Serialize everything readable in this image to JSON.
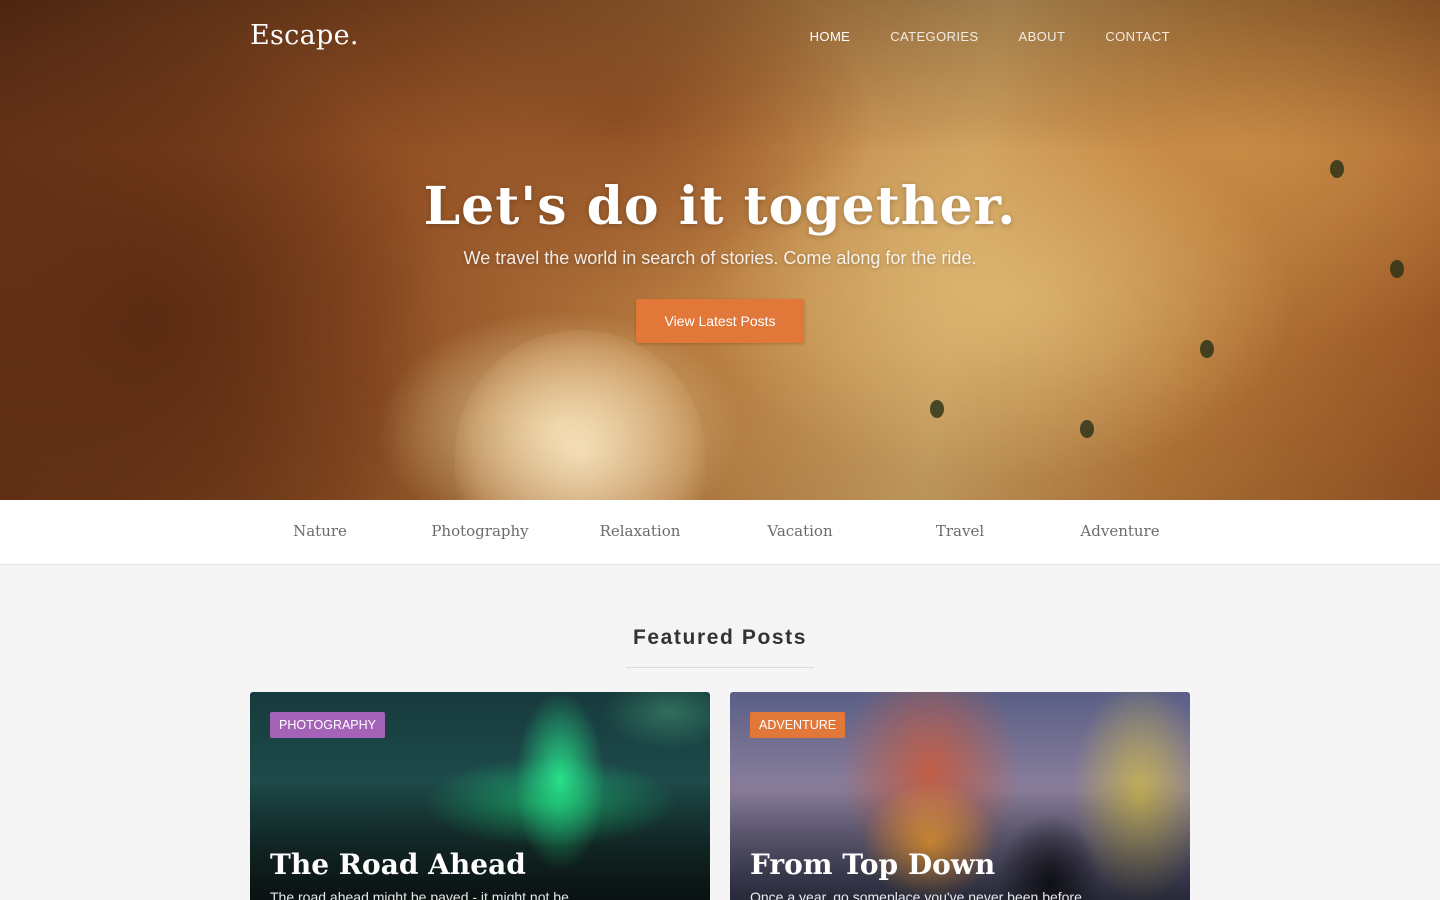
{
  "site": {
    "brand": "Escape.",
    "nav": [
      "HOME",
      "CATEGORIES",
      "ABOUT",
      "CONTACT"
    ],
    "active_nav": "HOME"
  },
  "hero": {
    "title": "Let's do it together.",
    "subtitle": "We travel the world in search of stories. Come along for the ride.",
    "button_label": "View Latest Posts"
  },
  "categories": [
    "Nature",
    "Photography",
    "Relaxation",
    "Vacation",
    "Travel",
    "Adventure"
  ],
  "featured": {
    "title": "Featured Posts",
    "posts": [
      {
        "badge": "PHOTOGRAPHY",
        "badge_color": "#a463b6",
        "title": "The Road Ahead",
        "excerpt": "The road ahead might be paved - it might not be."
      },
      {
        "badge": "ADVENTURE",
        "badge_color": "#e1783a",
        "title": "From Top Down",
        "excerpt": "Once a year, go someplace you've never been before."
      }
    ]
  },
  "colors": {
    "accent": "#e1783a",
    "photography_badge": "#a463b6",
    "background": "#f5f5f5"
  }
}
